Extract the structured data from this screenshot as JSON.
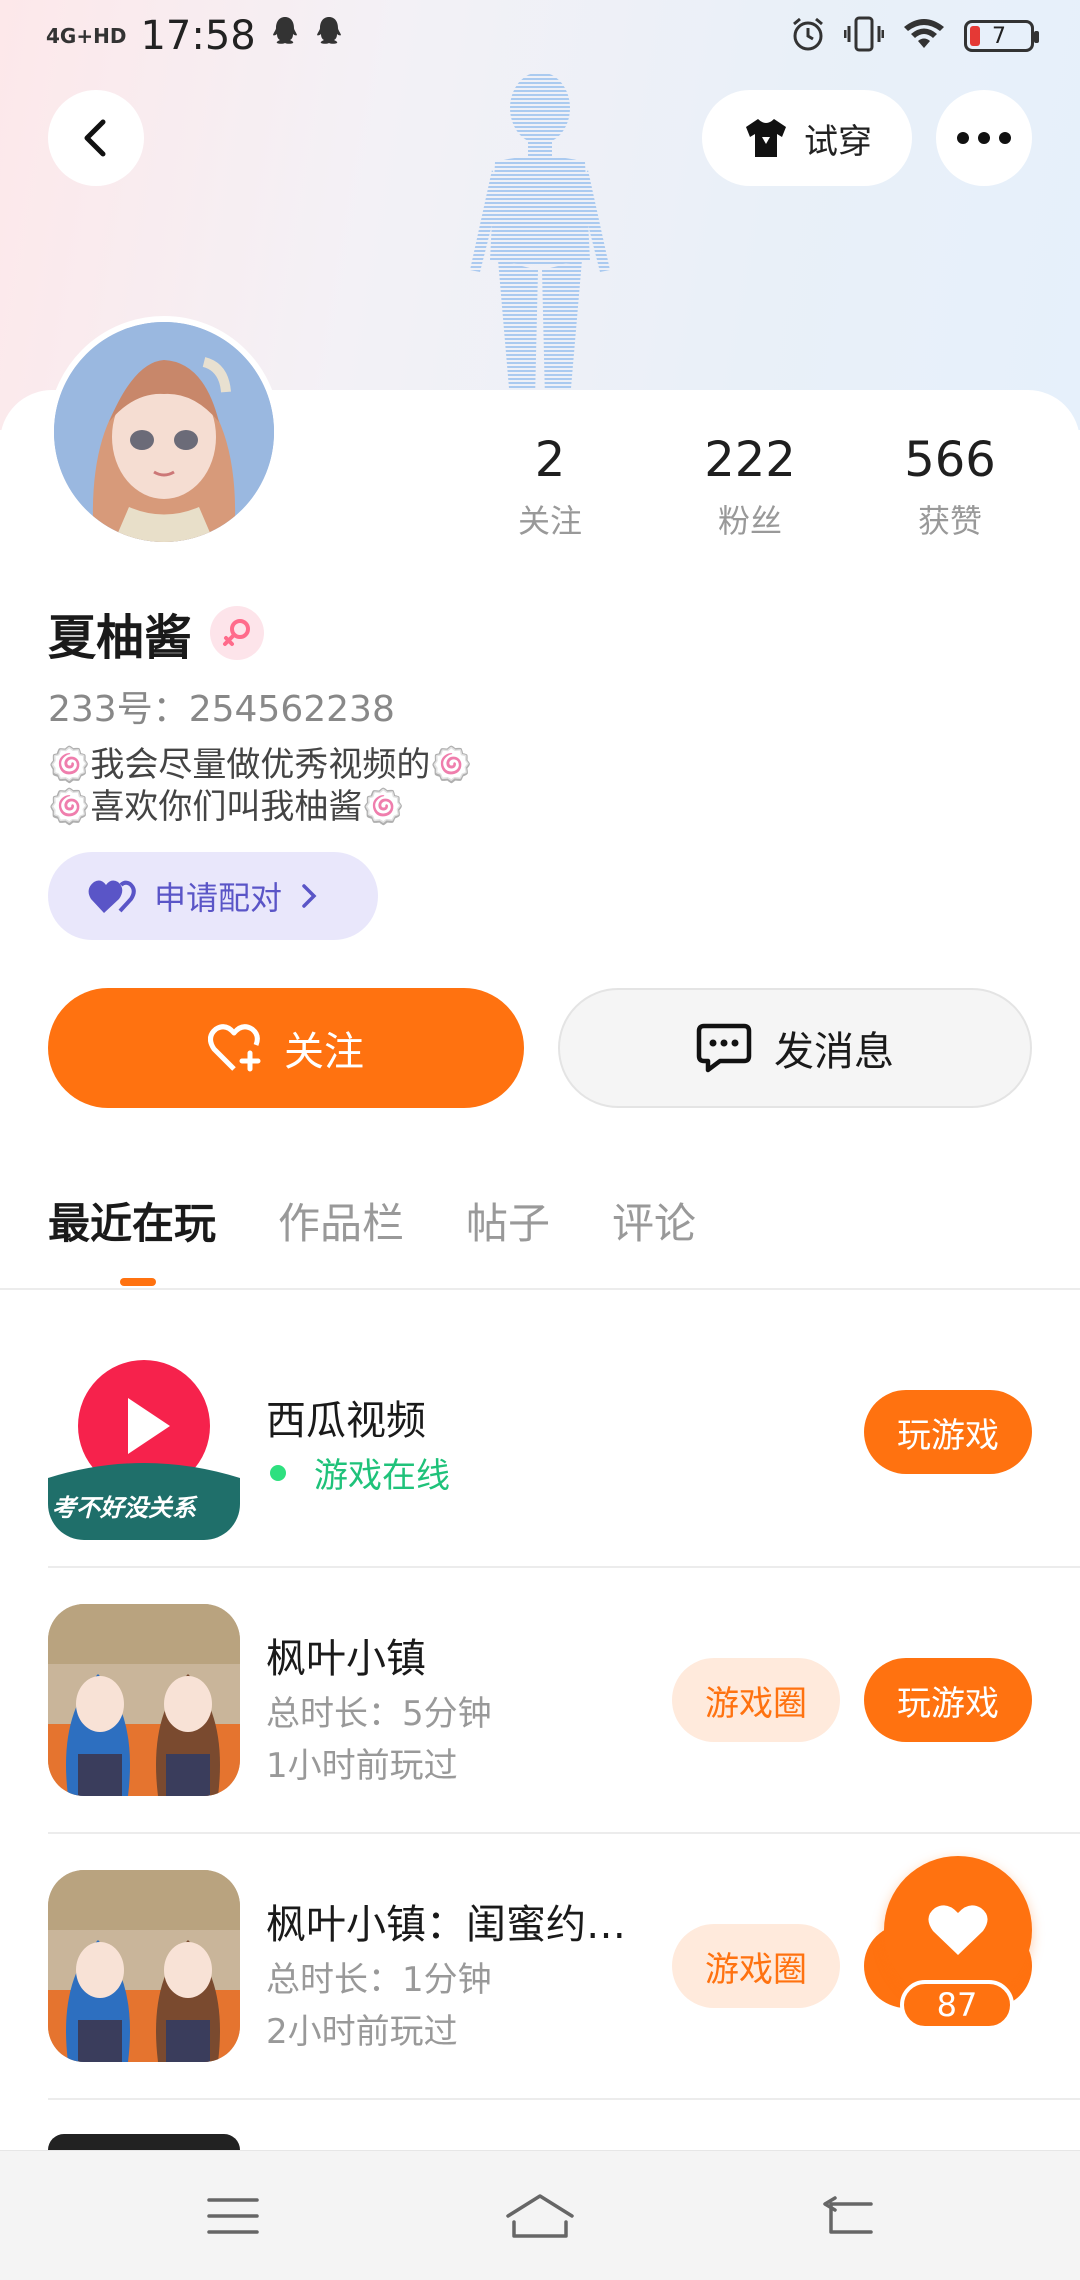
{
  "status_bar": {
    "network": "4G+HD",
    "time": "17:58",
    "notifications": [
      "qq-icon",
      "qq-icon"
    ],
    "battery": "7",
    "icons": [
      "alarm-icon",
      "vibrate-icon",
      "wifi-icon",
      "battery-icon"
    ]
  },
  "header": {
    "try_on_label": "试穿"
  },
  "profile": {
    "name": "夏柚酱",
    "uid": "233号：254562238",
    "bio_line1": "🍥我会尽量做优秀视频的🍥",
    "bio_line2": "🍥喜欢你们叫我柚酱🍥",
    "pair_label": "申请配对",
    "stats": [
      {
        "value": "2",
        "label": "关注"
      },
      {
        "value": "222",
        "label": "粉丝"
      },
      {
        "value": "566",
        "label": "获赞"
      }
    ]
  },
  "actions": {
    "follow_label": "关注",
    "message_label": "发消息"
  },
  "tabs": [
    {
      "label": "最近在玩",
      "active": true
    },
    {
      "label": "作品栏",
      "active": false
    },
    {
      "label": "帖子",
      "active": false
    },
    {
      "label": "评论",
      "active": false
    }
  ],
  "games": [
    {
      "title": "西瓜视频",
      "status": "游戏在线",
      "badge": "考不好没关系",
      "play_label": "玩游戏"
    },
    {
      "title": "枫叶小镇",
      "duration": "总时长：5分钟",
      "last_played": "1小时前玩过",
      "circle_label": "游戏圈",
      "play_label": "玩游戏"
    },
    {
      "title": "枫叶小镇：闺蜜约…",
      "duration": "总时长：1分钟",
      "last_played": "2小时前玩过",
      "circle_label": "游戏圈"
    }
  ],
  "fab": {
    "count": "87"
  },
  "colors": {
    "accent": "#ff7210",
    "online": "#1fc27a",
    "pair_bg": "#e9e7fb",
    "pair_text": "#5a55c7"
  }
}
